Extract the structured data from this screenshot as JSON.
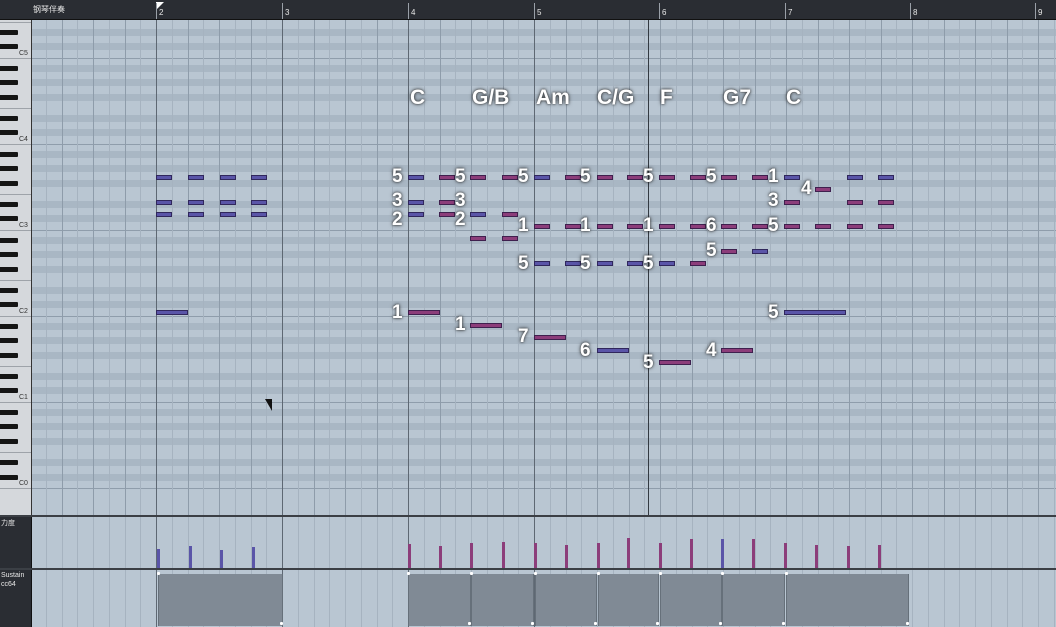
{
  "ruler": {
    "track_label": "钢琴伴奏",
    "bars": [
      "2",
      "3",
      "4",
      "5",
      "6",
      "7",
      "8",
      "9"
    ]
  },
  "keyboard": {
    "labels": [
      "C5",
      "C4",
      "C3",
      "C2",
      "C1",
      "C0"
    ]
  },
  "chords": [
    "C",
    "G/B",
    "Am",
    "C/G",
    "F",
    "G7",
    "C"
  ],
  "fingerings": [
    "5",
    "3",
    "2",
    "5",
    "3",
    "2",
    "5",
    "1",
    "5",
    "5",
    "1",
    "5",
    "5",
    "1",
    "5",
    "5",
    "6",
    "5",
    "1",
    "5",
    "3",
    "4",
    "1",
    "1",
    "7",
    "6",
    "5",
    "4",
    "5",
    "1"
  ],
  "velocity_lane": {
    "label": "力度"
  },
  "sustain_lane": {
    "label": "Sustain",
    "sub_label": "cc64"
  },
  "colors": {
    "grid_bg": "#b9c6d2",
    "note_blue": "#5a55a8",
    "note_magenta": "#8c3d7a"
  }
}
